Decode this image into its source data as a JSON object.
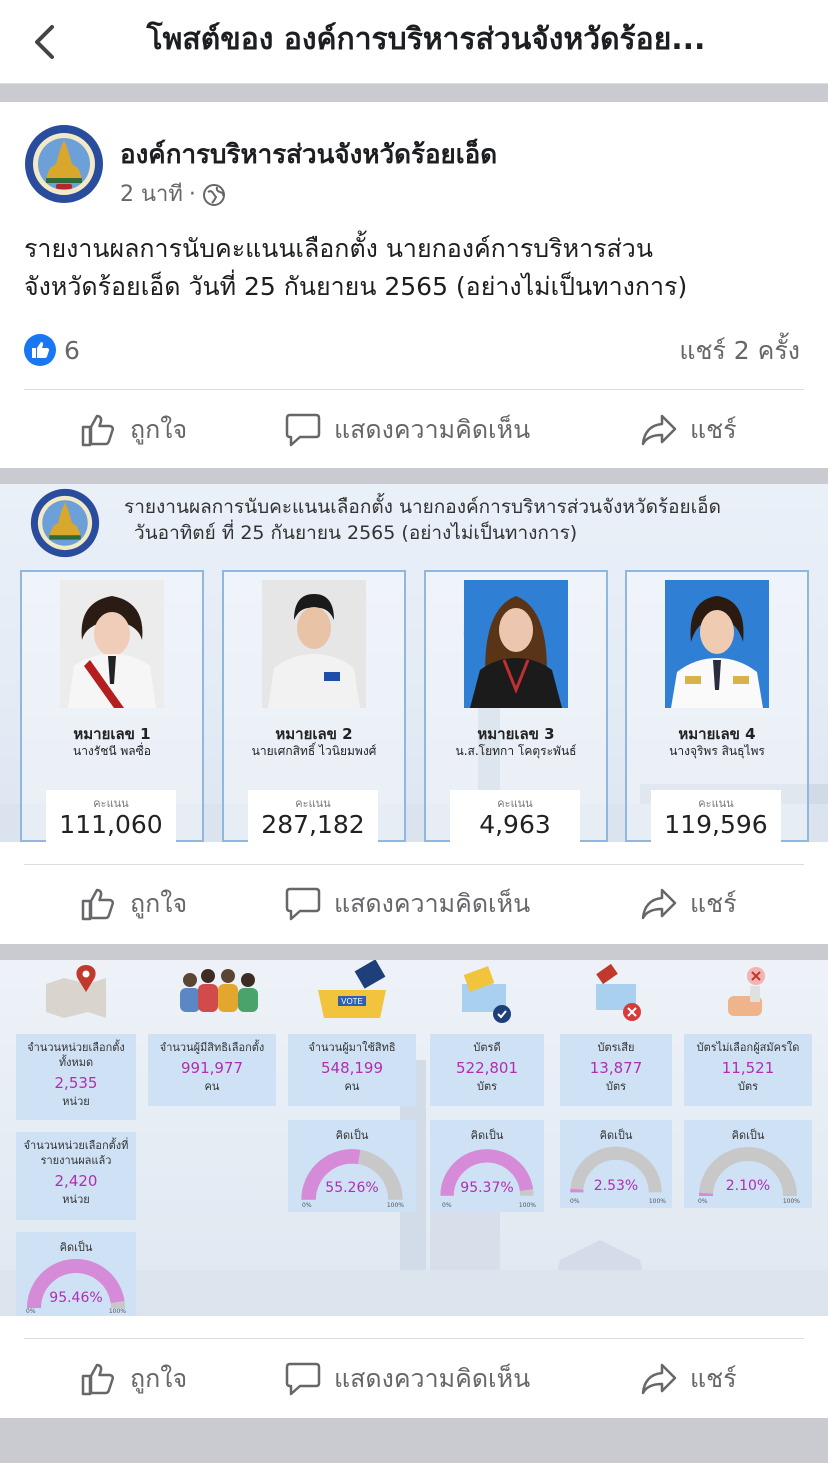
{
  "header": {
    "title": "โพสต์ของ องค์การบริหารส่วนจังหวัดร้อย..."
  },
  "post": {
    "author": "องค์การบริหารส่วนจังหวัดร้อยเอ็ด",
    "time": "2 นาที",
    "text_line1": "รายงานผลการนับคะแนนเลือกตั้ง นายกองค์การบริหารส่วน",
    "text_line2": "จังหวัดร้อยเอ็ด วันที่ 25 กันยายน 2565 (อย่างไม่เป็นทางการ)",
    "like_count": "6",
    "share_count": "แชร์ 2 ครั้ง"
  },
  "actions": {
    "like": "ถูกใจ",
    "comment": "แสดงความคิดเห็น",
    "share": "แชร์"
  },
  "image1": {
    "title_line1": "รายงานผลการนับคะแนนเลือกตั้ง นายกองค์การบริหารส่วนจังหวัดร้อยเอ็ด",
    "title_line2": "วันอาทิตย์ ที่ 25 กันยายน 2565 (อย่างไม่เป็นทางการ)",
    "score_label": "คะแนน",
    "candidates": [
      {
        "number": "หมายเลข 1",
        "name": "นางรัชนี พลซื่อ",
        "votes": "111,060"
      },
      {
        "number": "หมายเลข 2",
        "name": "นายเศกสิทธิ์ ไวนิยมพงศ์",
        "votes": "287,182"
      },
      {
        "number": "หมายเลข 3",
        "name": "น.ส.โยทกา โคตุระพันธ์",
        "votes": "4,963"
      },
      {
        "number": "หมายเลข 4",
        "name": "นางจุริพร สินธุไพร",
        "votes": "119,596"
      }
    ]
  },
  "image2": {
    "vote_badge": "VOTE",
    "percent_label": "คิดเป็น",
    "scale_min": "0%",
    "scale_max": "100%",
    "stats": [
      {
        "label": "จำนวนหน่วยเลือกตั้งทั้งหมด",
        "value": "2,535",
        "unit": "หน่วย"
      },
      {
        "label": "จำนวนผู้มีสิทธิเลือกตั้ง",
        "value": "991,977",
        "unit": "คน"
      },
      {
        "label": "จำนวนผู้มาใช้สิทธิ",
        "value": "548,199",
        "unit": "คน"
      },
      {
        "label": "บัตรดี",
        "value": "522,801",
        "unit": "บัตร"
      },
      {
        "label": "บัตรเสีย",
        "value": "13,877",
        "unit": "บัตร"
      },
      {
        "label": "บัตรไม่เลือกผู้สมัครใด",
        "value": "11,521",
        "unit": "บัตร"
      }
    ],
    "reported": {
      "label": "จำนวนหน่วยเลือกตั้งที่รายงานผลแล้ว",
      "value": "2,420",
      "unit": "หน่วย"
    },
    "gauges": [
      {
        "value": "95.46%",
        "pct": 95.46
      },
      {
        "value": "55.26%",
        "pct": 55.26
      },
      {
        "value": "95.37%",
        "pct": 95.37
      },
      {
        "value": "2.53%",
        "pct": 2.53
      },
      {
        "value": "2.10%",
        "pct": 2.1
      }
    ],
    "colors": {
      "gauge_fill": "#d58bd8",
      "gauge_track": "#c8c8c8",
      "box_bg": "#cfe1f4",
      "value_text": "#b02fb0"
    }
  },
  "colors": {
    "facebook_blue": "#1877f2",
    "text_secondary": "#65676b"
  }
}
